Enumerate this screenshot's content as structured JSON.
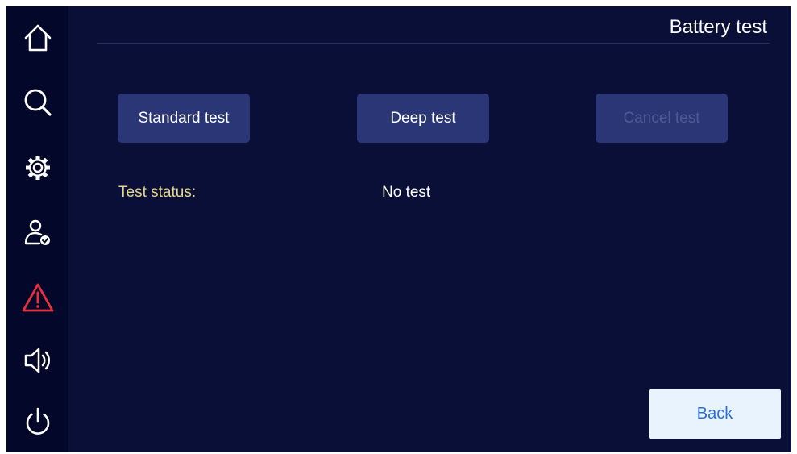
{
  "header": {
    "title": "Battery test"
  },
  "sidebar": {
    "items": [
      {
        "icon": "home-icon"
      },
      {
        "icon": "search-icon"
      },
      {
        "icon": "gear-icon"
      },
      {
        "icon": "user-check-icon"
      },
      {
        "icon": "warning-icon",
        "color": "#e8303c"
      },
      {
        "icon": "speaker-icon"
      },
      {
        "icon": "power-icon"
      }
    ]
  },
  "actions": {
    "standard_label": "Standard test",
    "deep_label": "Deep test",
    "cancel_label": "Cancel test",
    "cancel_enabled": false
  },
  "status": {
    "label": "Test status:",
    "value": "No test"
  },
  "footer": {
    "back_label": "Back"
  },
  "colors": {
    "background": "#0a0f38",
    "sidebar": "#03072a",
    "button": "#2a3676",
    "status_label": "#e4d98a",
    "back_button_bg": "#e9f3fd",
    "back_button_text": "#2a6de0",
    "alert": "#e8303c"
  }
}
